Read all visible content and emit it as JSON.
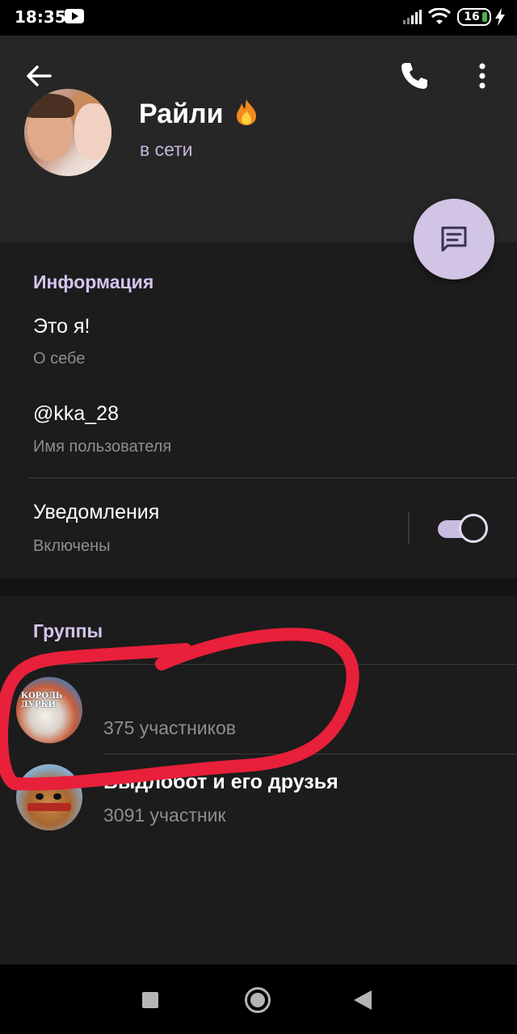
{
  "status_bar": {
    "time": "18:35",
    "battery": "16"
  },
  "profile": {
    "name": "Райли",
    "status": "в сети"
  },
  "info": {
    "title": "Информация",
    "bio_value": "Это я!",
    "bio_caption": "О себе",
    "username_value": "@kka_28",
    "username_caption": "Имя пользователя",
    "notifications_label": "Уведомления",
    "notifications_state": "Включены",
    "notifications_enabled": true
  },
  "groups": {
    "title": "Группы",
    "items": [
      {
        "name": "",
        "members": "375 участников",
        "avatar_text": "КОРОЛЬ ДУРКИ"
      },
      {
        "name": "Выдлобот и его друзья",
        "members": "3091 участник"
      }
    ]
  },
  "colors": {
    "accent": "#d4c5ee",
    "fab": "#d1c4e5",
    "annotation": "#e8203a",
    "header_bg": "#262626",
    "page_bg": "#1c1c1c"
  },
  "icons": {
    "back": "arrow-left",
    "call": "phone",
    "menu": "more-vertical",
    "fab": "message",
    "name_emoji": "fire"
  }
}
